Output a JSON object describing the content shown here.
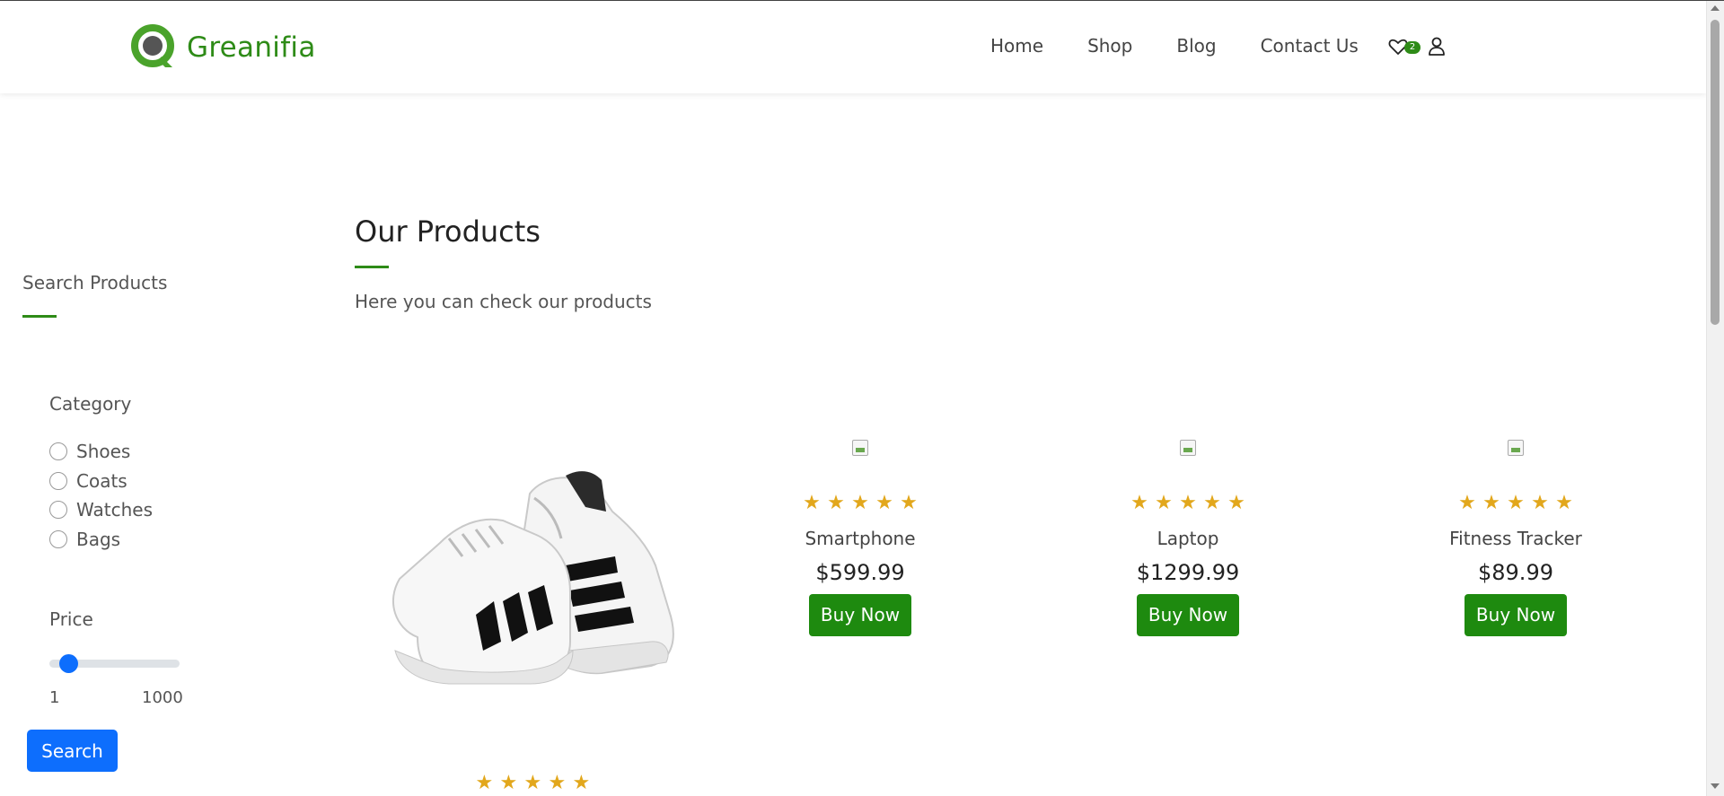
{
  "brand": {
    "name": "Greanifia",
    "accent": "#2e8b17"
  },
  "nav": {
    "links": [
      "Home",
      "Shop",
      "Blog",
      "Contact Us"
    ],
    "wishlist_count": "2",
    "icons": [
      "heart-icon",
      "user-icon"
    ]
  },
  "sidebar": {
    "title": "Search Products",
    "category_title": "Category",
    "categories": [
      "Shoes",
      "Coats",
      "Watches",
      "Bags"
    ],
    "price_title": "Price",
    "price_min": "1",
    "price_max": "1000",
    "slider_value_fraction": 0.02,
    "search_label": "Search"
  },
  "main": {
    "title": "Our Products",
    "subtitle": "Here you can check our products"
  },
  "products": [
    {
      "name": "Smartphone",
      "price": "$599.99",
      "rating": 5,
      "button": "Buy Now"
    },
    {
      "name": "Laptop",
      "price": "$1299.99",
      "rating": 5,
      "button": "Buy Now"
    },
    {
      "name": "Fitness Tracker",
      "price": "$89.99",
      "rating": 5,
      "button": "Buy Now"
    }
  ],
  "featured_product": {
    "rating": 5,
    "image": "sneakers-image"
  },
  "colors": {
    "button_green": "#1e8a0f",
    "star": "#e2a71c",
    "search_blue": "#0d6efd"
  }
}
